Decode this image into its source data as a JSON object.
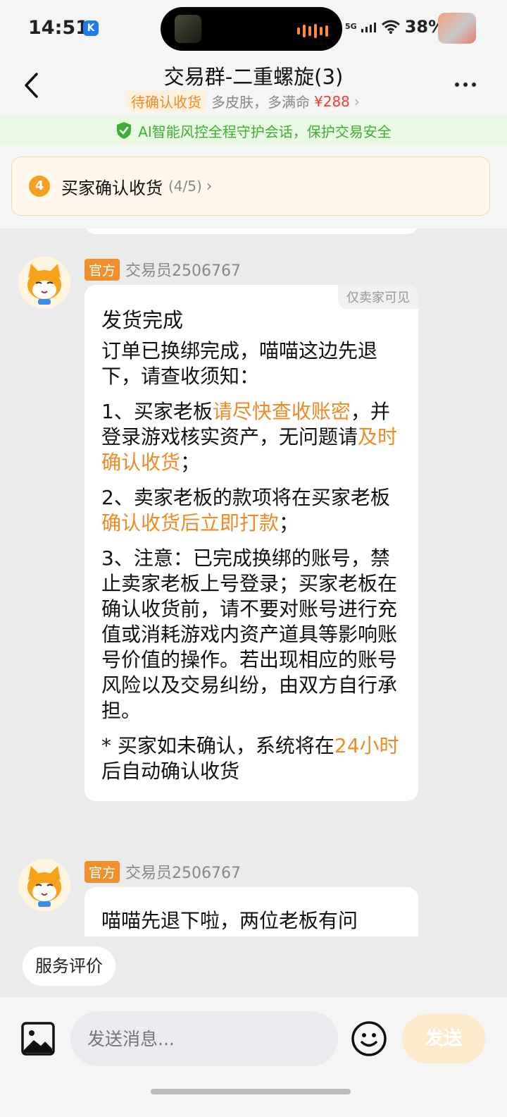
{
  "status_bar": {
    "time": "14:51",
    "k_badge": "K",
    "network": "5G",
    "battery": "38%"
  },
  "header": {
    "title": "交易群-二重螺旋(3)",
    "status_badge": "待确认收货",
    "product": "多皮肤，多满命",
    "price": "¥288",
    "chevron": "›"
  },
  "ai_bar": {
    "text": "AI智能风控全程守护会话，保护交易安全"
  },
  "progress": {
    "step_number": "4",
    "step_title": "买家确认收货",
    "step_count": "(4/5)",
    "chevron": "›"
  },
  "messages": [
    {
      "badge": "官方",
      "sender": "交易员2506767",
      "visibility_tag": "仅卖家可见",
      "title": "发货完成",
      "p1": "订单已换绑完成，喵喵这边先退下，请查收须知：",
      "p2_a": "1、买家老板",
      "p2_b": "请尽快查收账密",
      "p2_c": "，并登录游戏核实资产，无问题请",
      "p2_d": "及时确认收货",
      "p2_e": "；",
      "p3_a": "2、卖家老板的款项将在买家老板",
      "p3_b": "确认收货后立即打款",
      "p3_c": "；",
      "p4": "3、注意：已完成换绑的账号，禁止卖家老板上号登录；买家老板在确认收货前，请不要对账号进行充值或消耗游戏内资产道具等影响账号价值的操作。若出现相应的账号风险以及交易纠纷，由双方自行承担。",
      "p5_a": "* 买家如未确认，系统将在",
      "p5_b": "24小时",
      "p5_c": "后自动确认收货"
    },
    {
      "badge": "官方",
      "sender": "交易员2506767",
      "p1": "喵喵先退下啦，两位老板有问"
    }
  ],
  "bottom": {
    "rate_chip": "服务评价",
    "input_placeholder": "发送消息...",
    "send_label": "发送"
  },
  "colors": {
    "accent_orange": "#f08a24",
    "ai_green": "#3fae36",
    "price_red": "#ff3b30"
  }
}
